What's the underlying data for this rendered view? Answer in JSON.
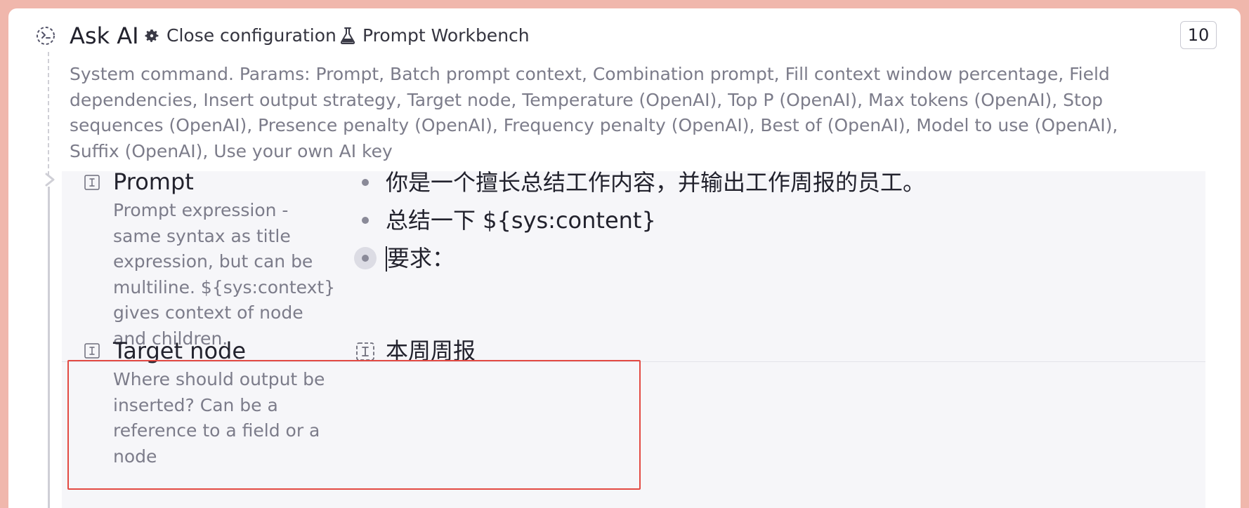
{
  "header": {
    "command_icon": "command-icon",
    "title": "Ask AI",
    "close_config_icon": "gear-icon",
    "close_config_label": "Close configuration",
    "workbench_icon": "flask-icon",
    "workbench_label": "Prompt Workbench",
    "count": "10"
  },
  "description": "System command. Params: Prompt, Batch prompt context, Combination prompt, Fill context window percentage, Field dependencies, Insert output strategy, Target node, Temperature (OpenAI), Top P (OpenAI), Max tokens (OpenAI), Stop sequences (OpenAI), Presence penalty (OpenAI), Frequency penalty (OpenAI), Best of (OpenAI), Model to use (OpenAI), Suffix (OpenAI), Use your own AI key",
  "fields": {
    "prompt": {
      "icon": "text-field-icon",
      "name": "Prompt",
      "help": "Prompt expression - same syntax as title expression, but can be multiline. ${sys:context} gives context of node and children.",
      "values": [
        "你是一个擅长总结工作内容，并输出工作周报的员工。",
        "总结一下 ${sys:content}",
        "要求："
      ]
    },
    "target_node": {
      "icon": "text-field-icon",
      "name": "Target node",
      "help": "Where should output be inserted? Can be a reference to a field or a node",
      "value_icon": "text-field-icon",
      "value": "本周周报"
    }
  },
  "colors": {
    "background": "#f0b7ac",
    "highlight": "#e34a43",
    "panel": "#f6f6f9"
  }
}
